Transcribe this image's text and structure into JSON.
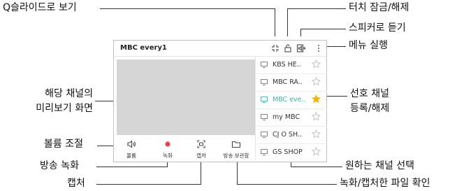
{
  "annotations": {
    "quick_view": "Q슬라이드로 보기",
    "touch_lock": "터치 잠금/해제",
    "speaker_listen": "스피커로 듣기",
    "menu_run": "메뉴 실행",
    "channel_preview_line1": "해당 채널의",
    "channel_preview_line2": "미리보기 화면",
    "favorite_line1": "선호 채널",
    "favorite_line2": "등록/해제",
    "volume_adjust": "볼륨 조절",
    "broadcast_record": "방송 녹화",
    "capture": "캡처",
    "select_channel": "원하는 채널 선택",
    "check_files": "녹화/캡처한 파일 확인"
  },
  "app": {
    "title": "MBC every1"
  },
  "controls": [
    {
      "label": "볼륨",
      "icon": "speaker-icon"
    },
    {
      "label": "녹화",
      "icon": "record-icon"
    },
    {
      "label": "캡처",
      "icon": "capture-icon"
    },
    {
      "label": "방송 보관함",
      "icon": "folder-icon"
    }
  ],
  "channels": [
    {
      "name": "KBS HE..",
      "favorite": false,
      "selected": false
    },
    {
      "name": "MBC RA..",
      "favorite": false,
      "selected": false
    },
    {
      "name": "MBC eve..",
      "favorite": true,
      "selected": true
    },
    {
      "name": "my MBC",
      "favorite": false,
      "selected": false
    },
    {
      "name": "CJ O SH..",
      "favorite": false,
      "selected": false
    },
    {
      "name": "GS SHOP",
      "favorite": false,
      "selected": false
    }
  ],
  "colors": {
    "accent": "#3db0a0",
    "record": "#e8454e",
    "star_active": "#f5b400",
    "star_inactive": "#bdbdbd",
    "preview_bg": "#d6d6d6"
  }
}
